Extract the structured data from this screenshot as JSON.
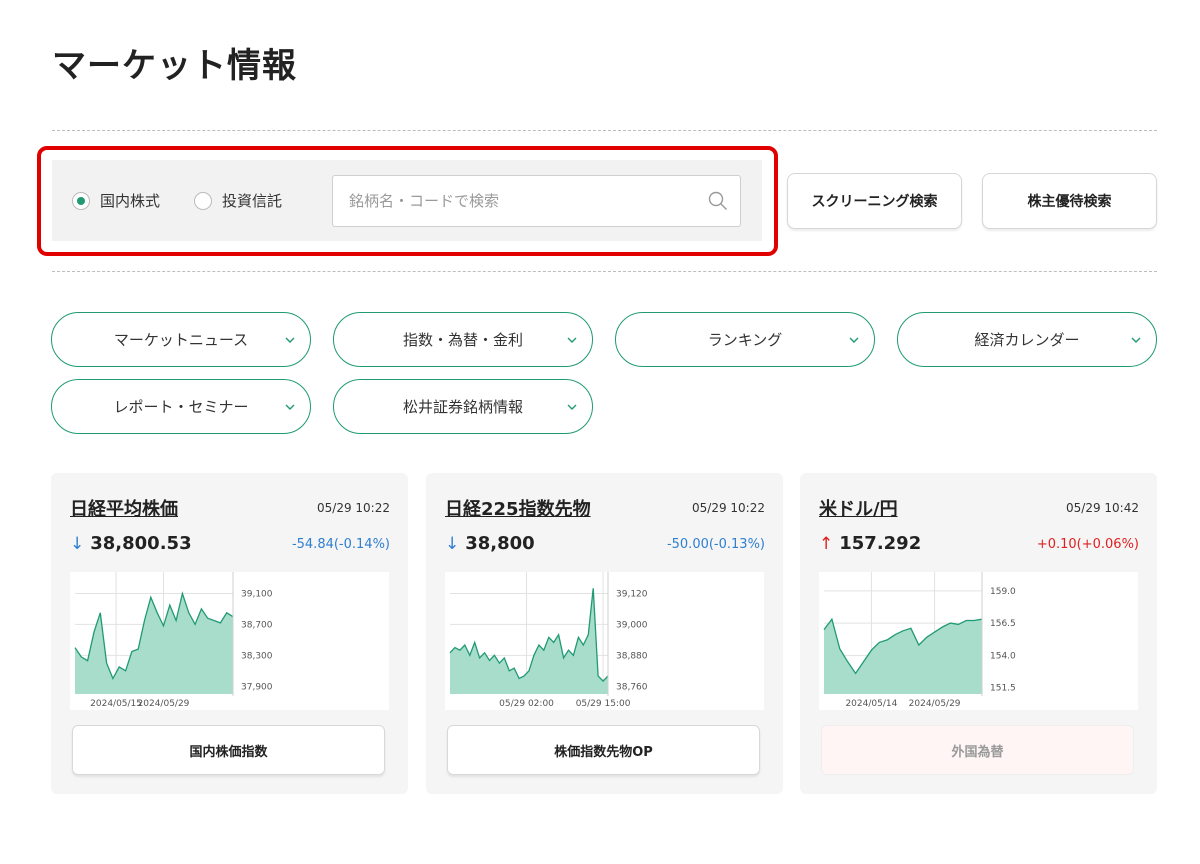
{
  "page": {
    "title": "マーケット情報"
  },
  "search": {
    "radio_domestic": "国内株式",
    "radio_fund": "投資信託",
    "placeholder": "銘柄名・コードで検索",
    "screening_button": "スクリーニング検索",
    "benefit_button": "株主優待検索"
  },
  "nav": [
    {
      "label": "マーケットニュース"
    },
    {
      "label": "指数・為替・金利"
    },
    {
      "label": "ランキング"
    },
    {
      "label": "経済カレンダー"
    },
    {
      "label": "レポート・セミナー"
    },
    {
      "label": "松井証券銘柄情報"
    }
  ],
  "colors": {
    "accent": "#1f9a74",
    "down": "#2f7fd1",
    "up": "#e02020",
    "highlight": "#e00000",
    "area_fill": "#a8dccb"
  },
  "cards": [
    {
      "name": "日経平均株価",
      "time": "05/29 10:22",
      "arrow": "↓",
      "price": "38,800.53",
      "change": "-54.84(-0.14%)",
      "direction": "down",
      "button": "国内株価指数",
      "button_disabled": false
    },
    {
      "name": "日経225指数先物",
      "time": "05/29 10:22",
      "arrow": "↓",
      "price": "38,800",
      "change": "-50.00(-0.13%)",
      "direction": "down",
      "button": "株価指数先物OP",
      "button_disabled": false
    },
    {
      "name": "米ドル/円",
      "time": "05/29 10:42",
      "arrow": "↑",
      "price": "157.292",
      "change": "+0.10(+0.06%)",
      "direction": "up",
      "button": "外国為替",
      "button_disabled": true
    }
  ],
  "chart_data": [
    {
      "type": "area",
      "title": "",
      "ylim": [
        37800,
        39300
      ],
      "yticks": [
        "39,100",
        "38,700",
        "38,300",
        "37,900"
      ],
      "ytick_values": [
        39100,
        38700,
        38300,
        37900
      ],
      "xticks": [
        "2024/05/15",
        "2024/05/29"
      ],
      "xtick_values": [
        6.5,
        14
      ],
      "x": [
        0,
        1,
        2,
        3,
        4,
        5,
        6,
        7,
        8,
        9,
        10,
        11,
        12,
        13,
        14,
        15,
        16,
        17,
        18,
        19,
        20,
        21,
        22,
        23,
        24,
        25
      ],
      "values": [
        38400,
        38280,
        38230,
        38600,
        38850,
        38200,
        38000,
        38150,
        38100,
        38350,
        38380,
        38750,
        39050,
        38850,
        38680,
        38950,
        38750,
        39100,
        38850,
        38700,
        38900,
        38780,
        38750,
        38720,
        38850,
        38800
      ]
    },
    {
      "type": "area",
      "title": "",
      "ylim": [
        38730,
        39180
      ],
      "yticks": [
        "39,120",
        "39,000",
        "38,880",
        "38,760"
      ],
      "ytick_values": [
        39120,
        39000,
        38880,
        38760
      ],
      "xticks": [
        "05/29 02:00",
        "05/29 15:00"
      ],
      "xtick_values": [
        31,
        62
      ],
      "x": [
        0,
        2,
        4,
        6,
        8,
        10,
        12,
        14,
        16,
        18,
        20,
        22,
        24,
        26,
        28,
        30,
        32,
        34,
        36,
        38,
        40,
        42,
        44,
        46,
        48,
        50,
        52,
        54,
        56,
        58,
        60,
        62,
        64
      ],
      "values": [
        38890,
        38910,
        38900,
        38920,
        38880,
        38930,
        38870,
        38890,
        38860,
        38880,
        38850,
        38870,
        38820,
        38830,
        38790,
        38800,
        38820,
        38880,
        38920,
        38900,
        38950,
        38930,
        38960,
        38870,
        38900,
        38880,
        38950,
        38920,
        38960,
        39140,
        38800,
        38780,
        38800
      ]
    },
    {
      "type": "area",
      "title": "",
      "ylim": [
        151.0,
        160.0
      ],
      "yticks": [
        "159.0",
        "156.5",
        "154.0",
        "151.5"
      ],
      "ytick_values": [
        159.0,
        156.5,
        154.0,
        151.5
      ],
      "xticks": [
        "2024/05/14",
        "2024/05/29"
      ],
      "xtick_values": [
        6,
        14
      ],
      "x": [
        0,
        1,
        2,
        3,
        4,
        5,
        6,
        7,
        8,
        9,
        10,
        11,
        12,
        13,
        14,
        15,
        16,
        17,
        18,
        19,
        20
      ],
      "values": [
        156.0,
        156.8,
        154.5,
        153.5,
        152.6,
        153.5,
        154.4,
        155.0,
        155.2,
        155.6,
        155.9,
        156.1,
        154.8,
        155.4,
        155.8,
        156.2,
        156.5,
        156.4,
        156.7,
        156.7,
        156.8
      ]
    }
  ]
}
